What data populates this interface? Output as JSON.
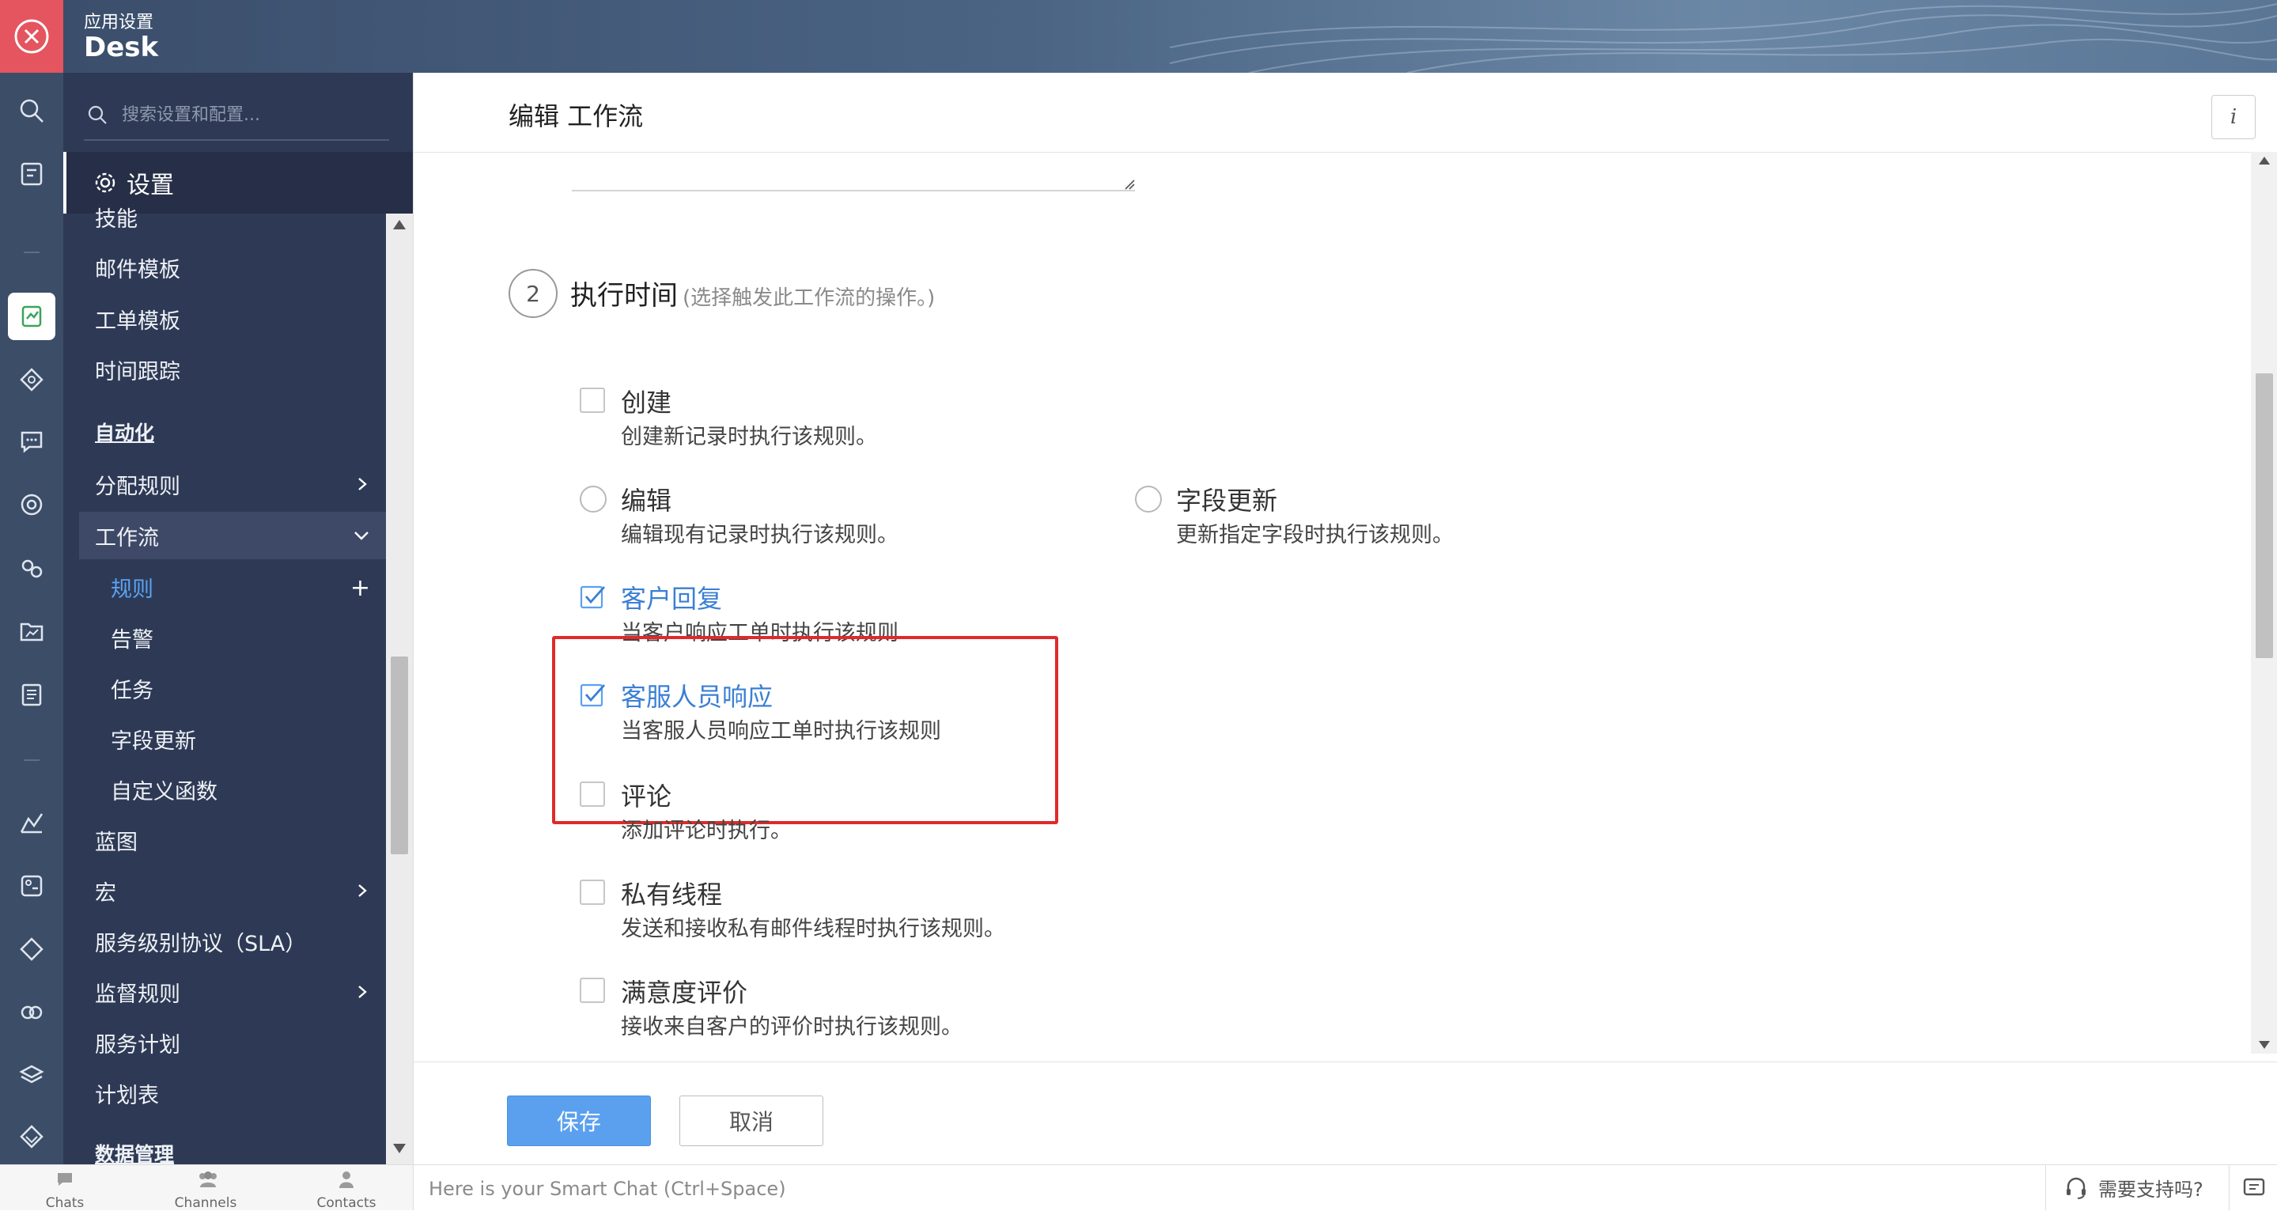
{
  "header": {
    "app_subtitle": "应用设置",
    "app_title": "Desk"
  },
  "search": {
    "placeholder": "搜索设置和配置..."
  },
  "settings_label": "设置",
  "sidebar": {
    "items": [
      {
        "label": "技能"
      },
      {
        "label": "邮件模板"
      },
      {
        "label": "工单模板"
      },
      {
        "label": "时间跟踪"
      },
      {
        "label": "自动化"
      },
      {
        "label": "分配规则"
      },
      {
        "label": "工作流"
      },
      {
        "label": "规则"
      },
      {
        "label": "告警"
      },
      {
        "label": "任务"
      },
      {
        "label": "字段更新"
      },
      {
        "label": "自定义函数"
      },
      {
        "label": "蓝图"
      },
      {
        "label": "宏"
      },
      {
        "label": "服务级别协议（SLA）"
      },
      {
        "label": "监督规则"
      },
      {
        "label": "服务计划"
      },
      {
        "label": "计划表"
      },
      {
        "label": "数据管理"
      }
    ]
  },
  "main": {
    "title": "编辑 工作流",
    "info_label": "i",
    "step": {
      "number": "2",
      "title": "执行时间",
      "hint": "(选择触发此工作流的操作。)"
    },
    "options": [
      {
        "title": "创建",
        "desc": "创建新记录时执行该规则。",
        "control": "checkbox",
        "checked": false
      },
      {
        "title": "编辑",
        "desc": "编辑现有记录时执行该规则。",
        "control": "radio",
        "checked": false
      },
      {
        "title": "字段更新",
        "desc": "更新指定字段时执行该规则。",
        "control": "radio",
        "checked": false
      },
      {
        "title": "客户回复",
        "desc": "当客户响应工单时执行该规则",
        "control": "checkbox",
        "checked": true
      },
      {
        "title": "客服人员响应",
        "desc": "当客服人员响应工单时执行该规则",
        "control": "checkbox",
        "checked": true
      },
      {
        "title": "评论",
        "desc": "添加评论时执行。",
        "control": "checkbox",
        "checked": false
      },
      {
        "title": "私有线程",
        "desc": "发送和接收私有邮件线程时执行该规则。",
        "control": "checkbox",
        "checked": false
      },
      {
        "title": "满意度评价",
        "desc": "接收来自客户的评价时执行该规则。",
        "control": "checkbox",
        "checked": false
      }
    ],
    "save_label": "保存",
    "cancel_label": "取消"
  },
  "bottom": {
    "tabs": [
      {
        "label": "Chats"
      },
      {
        "label": "Channels"
      },
      {
        "label": "Contacts"
      }
    ],
    "smart_chat_placeholder": "Here is your Smart Chat (Ctrl+Space)",
    "support_label": "需要支持吗?"
  },
  "colors": {
    "accent": "#5aa0ef",
    "highlight_border": "#e02a2a",
    "sidebar_bg": "#2e3a55",
    "close_red": "#e4555f"
  }
}
